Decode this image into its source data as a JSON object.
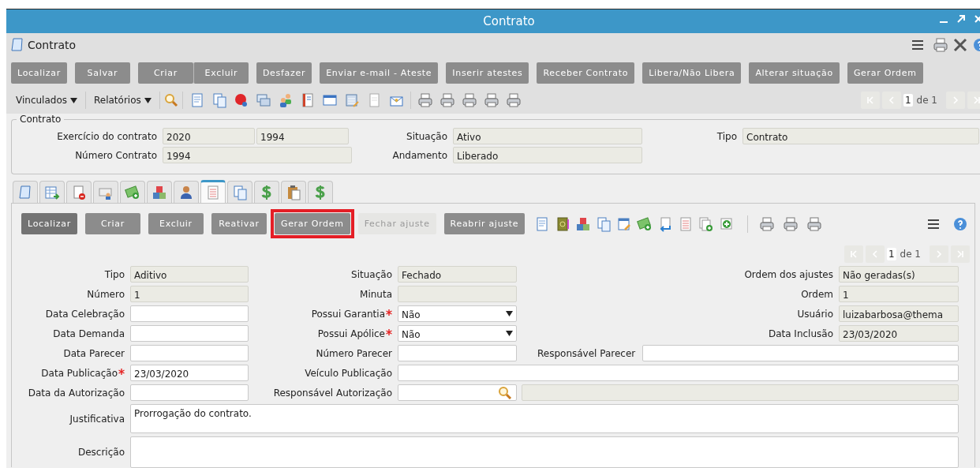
{
  "window": {
    "title": "Contrato"
  },
  "header": {
    "title": "Contrato"
  },
  "main_buttons": [
    {
      "label": "Localizar",
      "joined": false
    },
    {
      "label": "Salvar",
      "joined": false
    },
    {
      "label": "Criar",
      "joined": false
    },
    {
      "label": "Excluir",
      "joined": true
    },
    {
      "label": "Desfazer",
      "joined": false
    },
    {
      "label": "Enviar e-mail - Ateste",
      "joined": false
    },
    {
      "label": "Inserir atestes",
      "joined": false
    },
    {
      "label": "Receber Contrato",
      "joined": false
    },
    {
      "label": "Libera/Não Libera",
      "joined": false
    },
    {
      "label": "Alterar situação",
      "joined": false
    },
    {
      "label": "Gerar Ordem",
      "joined": false
    }
  ],
  "toolbar": {
    "menus": [
      {
        "label": "Vinculados"
      },
      {
        "label": "Relatórios"
      }
    ]
  },
  "pager": {
    "page": "1",
    "total": "de 1"
  },
  "contract": {
    "legend": "Contrato",
    "rows": [
      [
        {
          "label": "Exercício do contrato",
          "values": [
            "2020",
            "1994"
          ]
        },
        {
          "label": "Situação",
          "values": [
            "Ativo"
          ]
        },
        {
          "label": "Tipo",
          "values": [
            "Contrato"
          ]
        }
      ],
      [
        {
          "label": "Número Contrato",
          "values": [
            "1994"
          ]
        },
        {
          "label": "Andamento",
          "values": [
            "Liberado"
          ]
        }
      ]
    ]
  },
  "tabs": [
    {
      "selected": false
    },
    {
      "selected": false
    },
    {
      "selected": false
    },
    {
      "selected": false
    },
    {
      "selected": false
    },
    {
      "selected": false
    },
    {
      "selected": false
    },
    {
      "selected": true
    },
    {
      "selected": false
    },
    {
      "selected": false
    },
    {
      "selected": false
    },
    {
      "selected": false
    }
  ],
  "detail": {
    "buttons": [
      {
        "label": "Localizar",
        "primary": true,
        "highlighted": false,
        "disabled": false
      },
      {
        "label": "Criar",
        "primary": false,
        "highlighted": false,
        "disabled": false
      },
      {
        "label": "Excluir",
        "primary": false,
        "highlighted": false,
        "disabled": false
      },
      {
        "label": "Reativar",
        "primary": false,
        "highlighted": false,
        "disabled": false
      },
      {
        "label": "Gerar Ordem",
        "primary": false,
        "highlighted": true,
        "disabled": false
      },
      {
        "label": "Fechar ajuste",
        "primary": false,
        "highlighted": false,
        "disabled": true
      },
      {
        "label": "Reabrir ajuste",
        "primary": false,
        "highlighted": false,
        "disabled": false
      }
    ],
    "pager": {
      "page": "1",
      "total": "de 1"
    },
    "rows": [
      {
        "fields": [
          {
            "label": "Tipo",
            "kind": "readonly",
            "required": false,
            "value": "Aditivo"
          },
          {
            "label": "Situação",
            "kind": "readonly",
            "required": false,
            "value": "Fechado"
          },
          {
            "label": "Ordem dos ajustes",
            "kind": "readonly",
            "required": false,
            "value": "Não geradas(s)"
          }
        ]
      },
      {
        "fields": [
          {
            "label": "Número",
            "kind": "readonly",
            "required": false,
            "value": "1"
          },
          {
            "label": "Minuta",
            "kind": "readonly",
            "required": false
          },
          {
            "label": "Ordem",
            "kind": "readonly",
            "required": false,
            "value": "1"
          }
        ]
      },
      {
        "fields": [
          {
            "label": "Data Celebração",
            "kind": "text",
            "required": false
          },
          {
            "label": "Possui Garantia",
            "kind": "select",
            "required": true,
            "value": "Não"
          },
          {
            "label": "Usuário",
            "kind": "readonly",
            "required": false,
            "value": "luizabarbosa@thema"
          }
        ]
      },
      {
        "fields": [
          {
            "label": "Data Demanda",
            "kind": "text",
            "required": false
          },
          {
            "label": "Possui Apólice",
            "kind": "select",
            "required": true,
            "value": "Não"
          },
          {
            "label": "Data Inclusão",
            "kind": "readonly",
            "required": false,
            "value": "23/03/2020"
          }
        ]
      },
      {
        "fields": [
          {
            "label": "Data Parecer",
            "kind": "text",
            "required": false
          },
          {
            "label": "Número Parecer",
            "kind": "text",
            "required": false
          },
          {
            "label": "Responsável Parecer",
            "kind": "text",
            "required": false
          }
        ]
      },
      {
        "fields": [
          {
            "label": "Data Publicação",
            "kind": "text",
            "required": true,
            "value": "23/03/2020"
          },
          {
            "label": "Veículo Publicação",
            "kind": "text",
            "required": false
          }
        ]
      },
      {
        "fields": [
          {
            "label": "Data da Autorização",
            "kind": "text",
            "required": false
          },
          {
            "label": "Responsável Autorização",
            "kind": "lookup",
            "required": false
          },
          {
            "kind": "readonly",
            "required": false
          }
        ]
      },
      {
        "fields": [
          {
            "label": "Justificativa",
            "kind": "memo",
            "required": false,
            "value": "Prorrogação do contrato."
          }
        ]
      },
      {
        "fields": [
          {
            "label": "Descrição",
            "kind": "memo",
            "required": false
          }
        ]
      }
    ]
  }
}
